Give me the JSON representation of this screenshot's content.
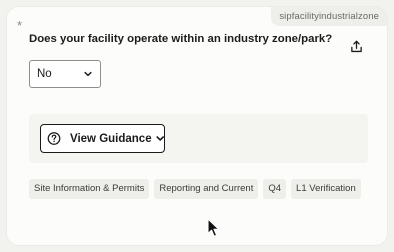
{
  "tag": {
    "text": "sipfacilityindustrialzone"
  },
  "required_marker": "*",
  "question": {
    "text": "Does your facility operate within an industry zone/park?"
  },
  "share": {
    "icon": "share-icon"
  },
  "answer_select": {
    "value": "No",
    "icon": "chevron-down-icon"
  },
  "guidance": {
    "label": "View Guidance",
    "icon": "question-circle-icon",
    "chevron": "chevron-down-icon"
  },
  "chips": [
    {
      "label": "Site Information & Permits"
    },
    {
      "label": "Reporting and Current"
    },
    {
      "label": "Q4"
    },
    {
      "label": "L1 Verification"
    }
  ],
  "colors": {
    "background": "#f2f2ef",
    "card": "#fcfcfa",
    "accent": "#1a1a1a",
    "chip": "#eeeeea"
  }
}
